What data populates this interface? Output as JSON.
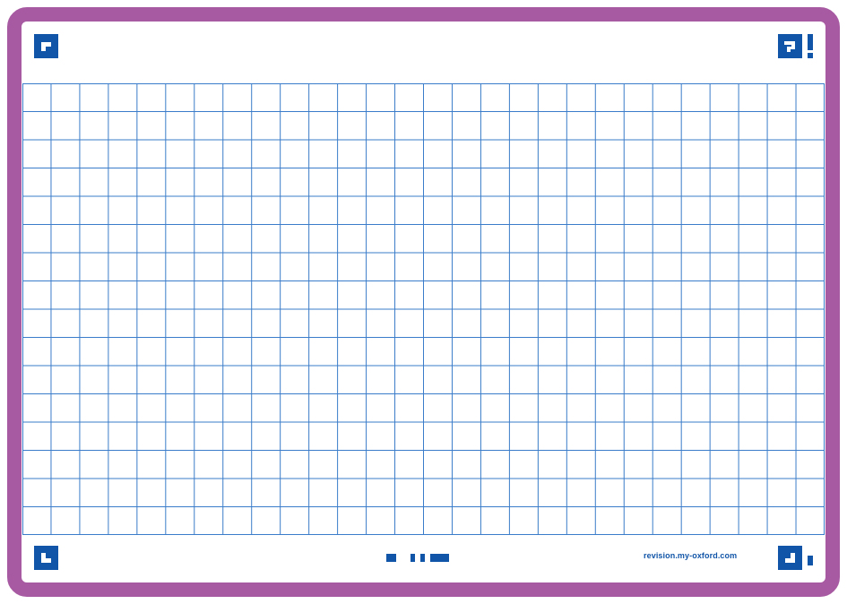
{
  "card": {
    "border_color": "#a75aa1",
    "grid_color": "#3a7cc9",
    "brand_color": "#1155a8",
    "grid_columns": 28,
    "grid_rows": 16
  },
  "footer": {
    "url": "revision.my-oxford.com"
  },
  "icons": {
    "top_left": "corner-mark-icon",
    "top_right": "question-exclamation-icon",
    "bottom_left": "corner-mark-icon",
    "bottom_center": "barcode-dash-icon",
    "bottom_right": "corner-mark-icon"
  }
}
